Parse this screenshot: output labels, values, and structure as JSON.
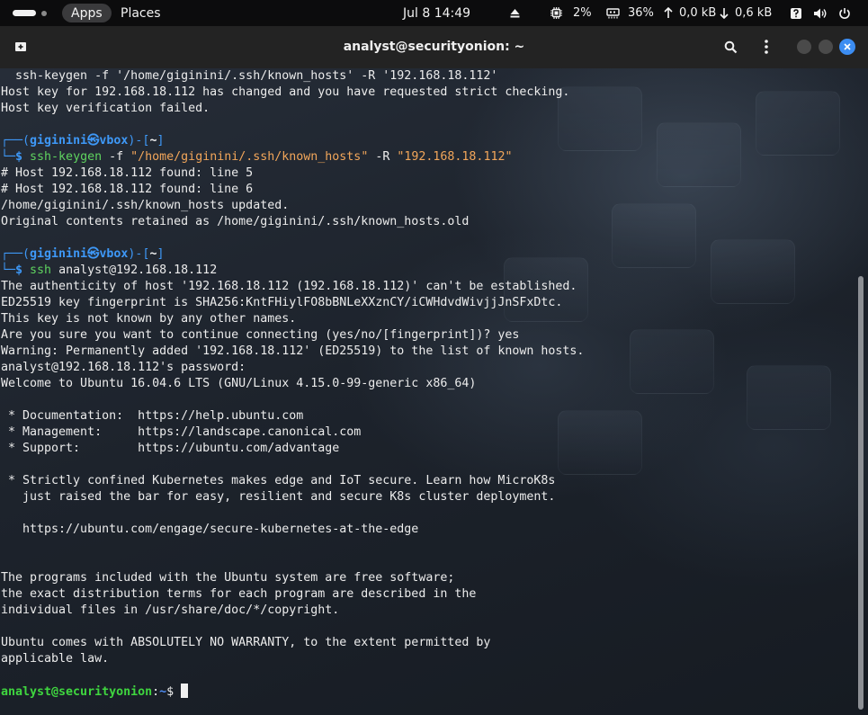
{
  "topbar": {
    "apps_label": "Apps",
    "places_label": "Places",
    "clock": "Jul 8  14:49",
    "cpu": "2%",
    "memory": "36%",
    "upload": "0,0 kB",
    "download": "0,6 kB"
  },
  "window": {
    "title": "analyst@securityonion: ~"
  },
  "terminal": {
    "lines": {
      "l01": "  ssh-keygen -f '/home/giginini/.ssh/known_hosts' -R '192.168.18.112'",
      "l02": "Host key for 192.168.18.112 has changed and you have requested strict checking.",
      "l03": "Host key verification failed.",
      "p1_user": "giginini",
      "p1_at": "㉿",
      "p1_host": "vbox",
      "p1_dir": "~",
      "c1_cmd": "ssh-keygen",
      "c1_flag1": "-f",
      "c1_arg1": "\"/home/giginini/.ssh/known_hosts\"",
      "c1_flag2": "-R",
      "c1_arg2": "\"192.168.18.112\"",
      "l06": "# Host 192.168.18.112 found: line 5",
      "l07": "# Host 192.168.18.112 found: line 6",
      "l08": "/home/giginini/.ssh/known_hosts updated.",
      "l09": "Original contents retained as /home/giginini/.ssh/known_hosts.old",
      "p2_user": "giginini",
      "p2_at": "㉿",
      "p2_host": "vbox",
      "p2_dir": "~",
      "c2_cmd": "ssh",
      "c2_arg": "analyst@192.168.18.112",
      "l13": "The authenticity of host '192.168.18.112 (192.168.18.112)' can't be established.",
      "l14": "ED25519 key fingerprint is SHA256:KntFHiylFO8bBNLeXXznCY/iCWHdvdWivjjJnSFxDtc.",
      "l15": "This key is not known by any other names.",
      "l16": "Are you sure you want to continue connecting (yes/no/[fingerprint])? yes",
      "l17": "Warning: Permanently added '192.168.18.112' (ED25519) to the list of known hosts.",
      "l18": "analyst@192.168.18.112's password:",
      "l19": "Welcome to Ubuntu 16.04.6 LTS (GNU/Linux 4.15.0-99-generic x86_64)",
      "l21": " * Documentation:  https://help.ubuntu.com",
      "l22": " * Management:     https://landscape.canonical.com",
      "l23": " * Support:        https://ubuntu.com/advantage",
      "l25": " * Strictly confined Kubernetes makes edge and IoT secure. Learn how MicroK8s",
      "l26": "   just raised the bar for easy, resilient and secure K8s cluster deployment.",
      "l28": "   https://ubuntu.com/engage/secure-kubernetes-at-the-edge",
      "l31": "The programs included with the Ubuntu system are free software;",
      "l32": "the exact distribution terms for each program are described in the",
      "l33": "individual files in /usr/share/doc/*/copyright.",
      "l35": "Ubuntu comes with ABSOLUTELY NO WARRANTY, to the extent permitted by",
      "l36": "applicable law.",
      "final_user_host": "analyst@securityonion",
      "final_path": "~",
      "final_symbol": "$"
    }
  },
  "icons": {
    "new_tab": "new-tab-icon",
    "search": "search-icon",
    "menu": "kebab-menu-icon",
    "close": "close-icon",
    "cpu": "cpu-icon",
    "memory": "memory-icon",
    "upload": "arrow-up-icon",
    "download": "arrow-down-icon",
    "help": "help-icon",
    "volume": "volume-icon",
    "power": "power-icon",
    "eject": "eject-icon"
  },
  "colors": {
    "prompt_blue": "#3e98f7",
    "prompt_green": "#5fd35f",
    "string_orange": "#f2a65a",
    "close_button": "#3c8df2"
  }
}
